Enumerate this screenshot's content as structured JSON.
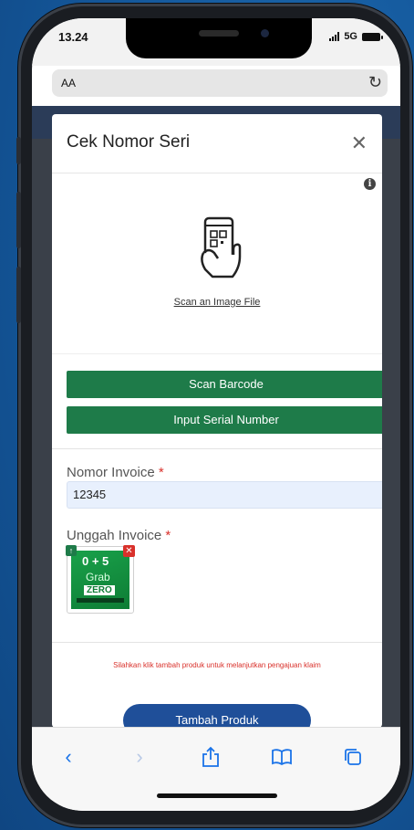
{
  "status_bar": {
    "time": "13.24",
    "network": "5G"
  },
  "browser": {
    "address_label": "AA"
  },
  "modal": {
    "title": "Cek Nomor Seri",
    "scan_link": "Scan an Image File",
    "buttons": {
      "scan_barcode": "Scan Barcode",
      "input_serial": "Input Serial Number"
    },
    "invoice_number": {
      "label": "Nomor Invoice",
      "required_mark": "*",
      "value": "12345"
    },
    "invoice_upload": {
      "label": "Unggah Invoice",
      "required_mark": "*",
      "thumbnail_text": {
        "top": "0 + 5",
        "brand": "Grab",
        "banner": "ZERO"
      }
    },
    "hint": "Silahkan klik tambah produk untuk melanjutkan pengajuan klaim",
    "primary_button": "Tambah Produk"
  },
  "colors": {
    "green": "#1e7b49",
    "navy": "#1f4f99",
    "required": "#d9312b",
    "toolbar_icon": "#1a73e8"
  },
  "toolbar_icons": [
    "back-icon",
    "forward-icon",
    "share-icon",
    "bookmarks-icon",
    "tabs-icon"
  ]
}
